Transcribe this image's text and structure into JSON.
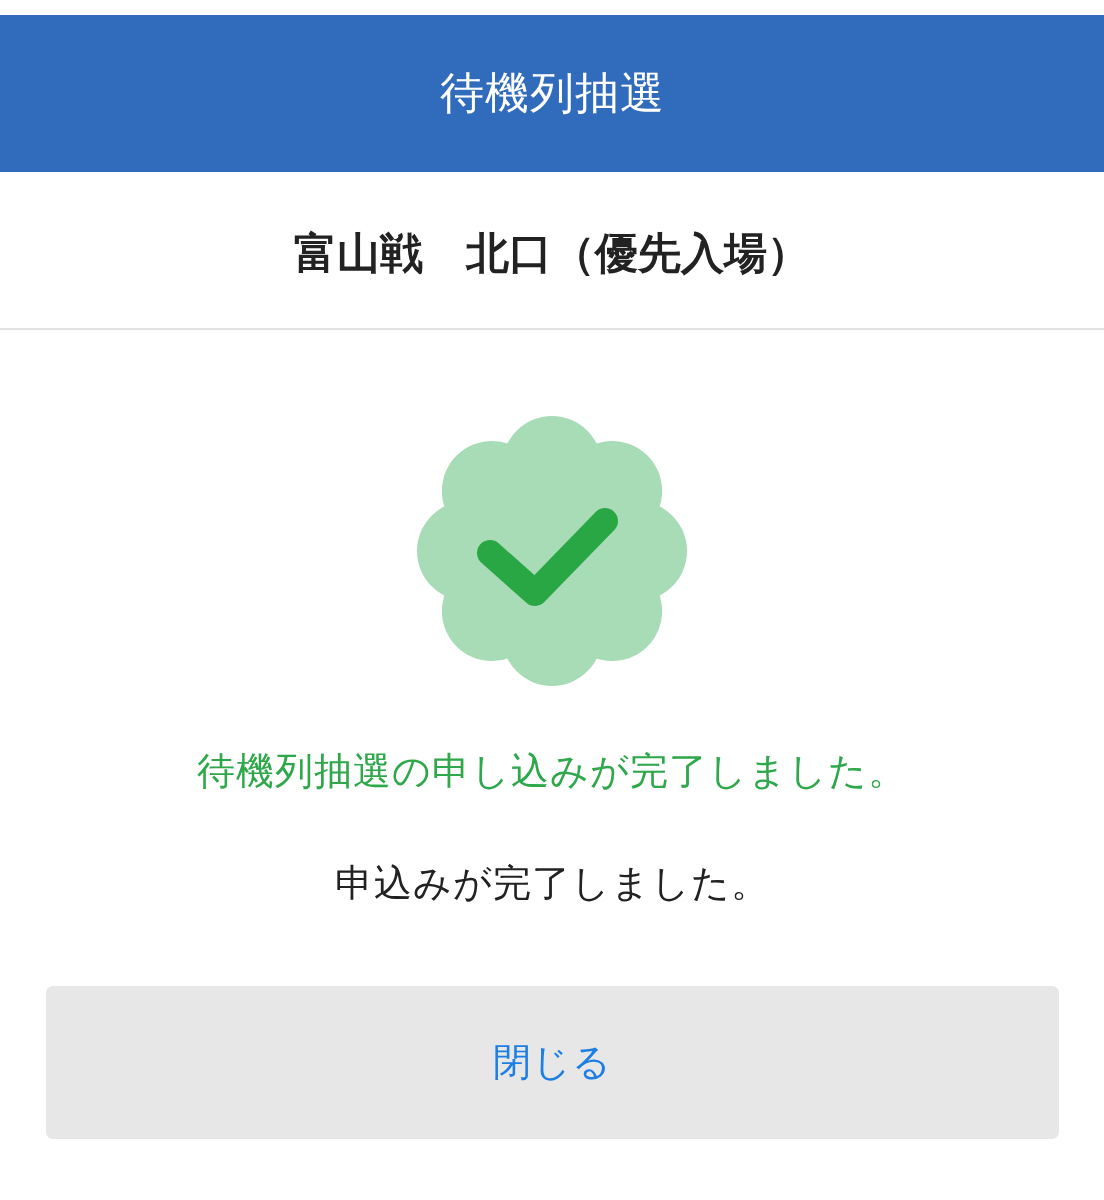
{
  "header": {
    "title": "待機列抽選"
  },
  "event": {
    "title": "富山戦　北口（優先入場）"
  },
  "messages": [
    {
      "kind": "success",
      "text": "待機列抽選の申し込みが完了しました。"
    },
    {
      "kind": "info",
      "text": "申込みが完了しました。"
    }
  ],
  "buttons": [
    {
      "label": "閉じる"
    }
  ]
}
